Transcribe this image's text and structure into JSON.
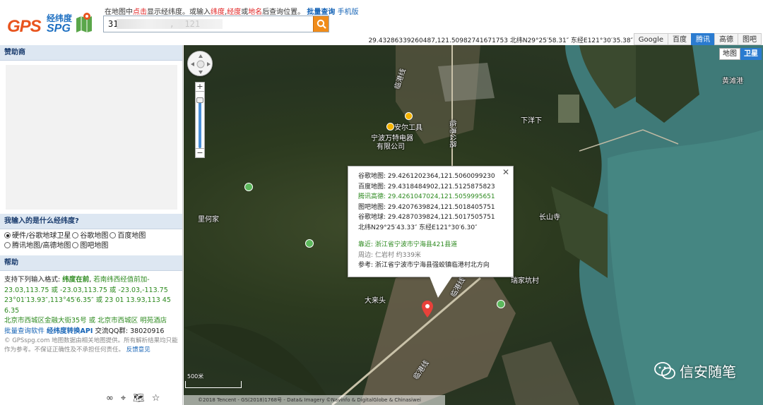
{
  "header": {
    "logo_gps": "GPS",
    "logo_spg": "SPG",
    "logo_subtitle": "经纬度",
    "tip_1": "在地图中",
    "tip_click": "点击",
    "tip_2": "显示经纬度。或输入",
    "tip_lat": "纬度",
    "tip_sep": ",",
    "tip_lng": "经度",
    "tip_or": "或",
    "tip_place": "地名",
    "tip_3": "后查询位置。",
    "batch_query": "批量查询",
    "mobile": "手机版",
    "search_value": "31          ,  121",
    "coord_readout": "29.43286339260487,121.50982741671753 北纬N29°25′58.31″ 东经E121°30′35.38″"
  },
  "map_tabs": [
    "Google",
    "百度",
    "腾讯",
    "高德",
    "图吧"
  ],
  "active_map_tab": "腾讯",
  "sidebar": {
    "sponsor_title": "赞助商",
    "input_title": "我输入的是什么经纬度?",
    "radio_options": [
      "硬件/谷歌地球卫星",
      "谷歌地图",
      "百度地图",
      "腾讯地图/高德地图",
      "图吧地图"
    ],
    "radio_selected": "硬件/谷歌地球卫星",
    "help_title": "帮助",
    "help_line1_prefix": "支持下列输入格式:",
    "help_line1_bold": "纬度在前",
    "help_line1_suffix": "若南纬西经值前加-",
    "help_line2": "23.03,113.75 或 -23.03,113.75 或 -23.03,-113.75",
    "help_line3": "23°01′13.93″,113°45′6.35″ 或 23 01 13.93,113 45 6.35",
    "help_line4_a": "北京市西城区金融大街35号 或 北京市西城区",
    "help_line4_b": "明苑酒店",
    "help_batch": "批量查询软件",
    "help_convert": "经纬度转换API",
    "help_qq": "交流QQ群: 38020916",
    "copyright": "© GPSspg.com 地图数据由相关地图提供。所有解析结果均只能作为参考。不保证正确性及不承担任何责任。",
    "feedback": "反馈意见"
  },
  "map": {
    "layer_buttons": [
      "地图",
      "卫星"
    ],
    "active_layer": "卫星",
    "labels": {
      "linkang": "临港线",
      "anerqi": "安尔工具",
      "ningbo": "宁波万特电器",
      "youxian": "有限公司",
      "lingang_gonglu": "临港公路",
      "xiayangxia": "下洋下",
      "huangshi": "黄滩港",
      "lilijia": "里何家",
      "dalaitou": "大来头",
      "changshansi": "长山寺",
      "shikengcun": "瑞家坑村",
      "linggangxian": "临港线",
      "lingang_bottom": "临港线"
    },
    "popup": {
      "google": "谷歌地图: 29.4261202364,121.5060099230",
      "baidu": "百度地图: 29.4318484902,121.5125875823",
      "tencent": "腾讯高德: 29.4261047024,121.5059995651",
      "tuba": "图吧地图: 29.4207639824,121.5018405751",
      "earth": "谷歌地球: 29.4287039824,121.5017505751",
      "dms": "北纬N29°25′43.33″ 东经E121°30′6.30″",
      "near": "靠近: 浙江省宁波市宁海县421县道",
      "around": "周边: 仁岩村 约339米",
      "ref": "参考: 浙江省宁波市宁海县强蛟镇临港村北方向"
    },
    "footer": "©2018 Tencent - GS(2018)1768号 - Data& Imagery ©Navinfo & DigitalGlobe & Chinasiwei",
    "scale": "500米",
    "watermark": "信安随笔"
  },
  "colors": {
    "accent_blue": "#2a7bd0",
    "logo_orange": "#e8541e",
    "link_blue": "#1563b6",
    "green_text": "#2d8a1f",
    "search_button": "#f08c1a"
  },
  "zoom_level_fraction": 0.85
}
